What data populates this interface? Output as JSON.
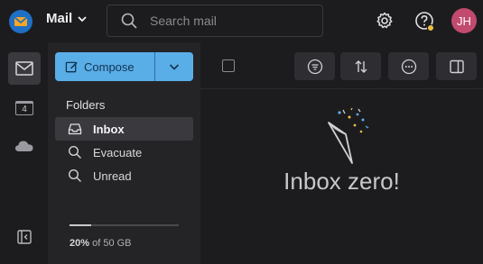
{
  "header": {
    "app_title": "Mail",
    "search_placeholder": "Search mail",
    "avatar_initials": "JH",
    "colors": {
      "logo": "#1f6fc4",
      "avatar": "#c24a6e",
      "notification_dot": "#f0c040"
    }
  },
  "rail": {
    "items": [
      {
        "name": "mail",
        "icon": "envelope-icon",
        "active": true
      },
      {
        "name": "calendar",
        "icon": "calendar-icon",
        "badge": "4"
      },
      {
        "name": "drive",
        "icon": "cloud-icon"
      }
    ],
    "collapse_icon": "collapse-sidebar-icon"
  },
  "sidebar": {
    "compose_label": "Compose",
    "compose_color": "#5aaee8",
    "folders_heading": "Folders",
    "folders": [
      {
        "label": "Inbox",
        "icon": "inbox-icon",
        "active": true
      },
      {
        "label": "Evacuate",
        "icon": "search-icon"
      },
      {
        "label": "Unread",
        "icon": "search-icon"
      }
    ],
    "storage": {
      "used_percent": "20%",
      "of_label": "of 50 GB",
      "fraction": 0.2
    }
  },
  "main": {
    "toolbar_icons": [
      "filter-icon",
      "sort-icon",
      "more-icon",
      "reading-pane-icon"
    ],
    "empty_state_text": "Inbox zero!"
  }
}
